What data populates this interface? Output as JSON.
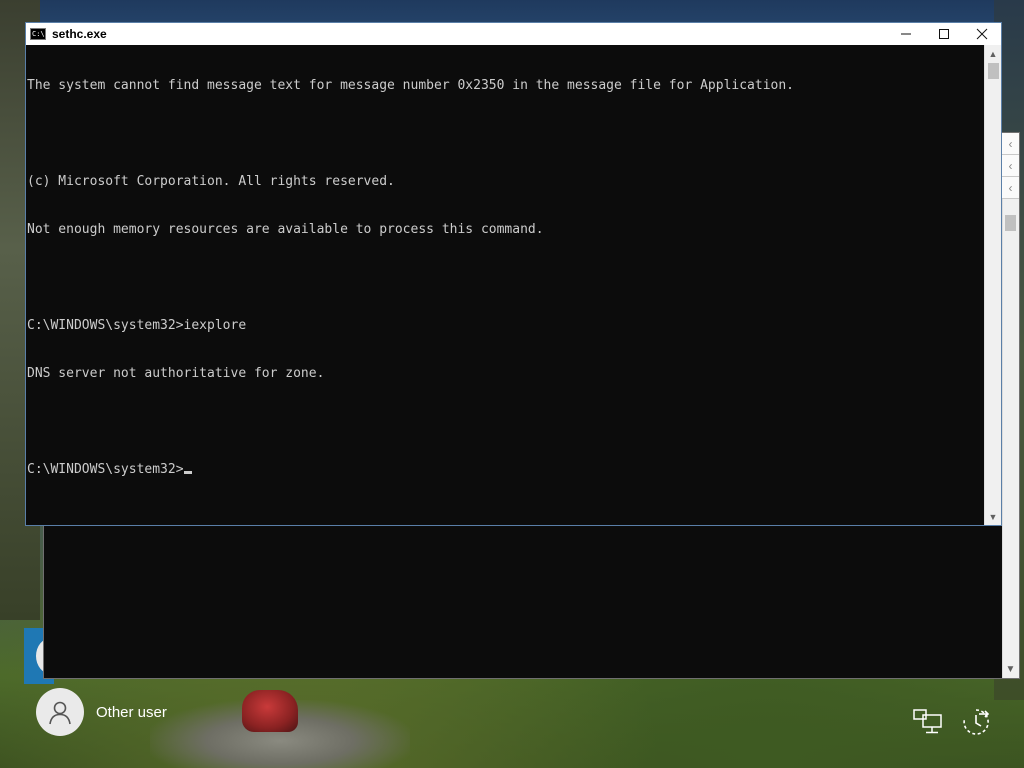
{
  "window": {
    "title": "sethc.exe"
  },
  "console": {
    "lines": [
      "The system cannot find message text for message number 0x2350 in the message file for Application.",
      "",
      "(c) Microsoft Corporation. All rights reserved.",
      "Not enough memory resources are available to process this command.",
      "",
      "C:\\WINDOWS\\system32>iexplore",
      "DNS server not authoritative for zone.",
      ""
    ],
    "prompt": "C:\\WINDOWS\\system32>"
  },
  "lockscreen": {
    "user_name": "Other user",
    "icons": [
      "network-icon",
      "accessibility-icon"
    ]
  },
  "colors": {
    "console_bg": "#0c0c0c",
    "console_fg": "#cccccc",
    "titlebar_bg": "#ffffff"
  }
}
